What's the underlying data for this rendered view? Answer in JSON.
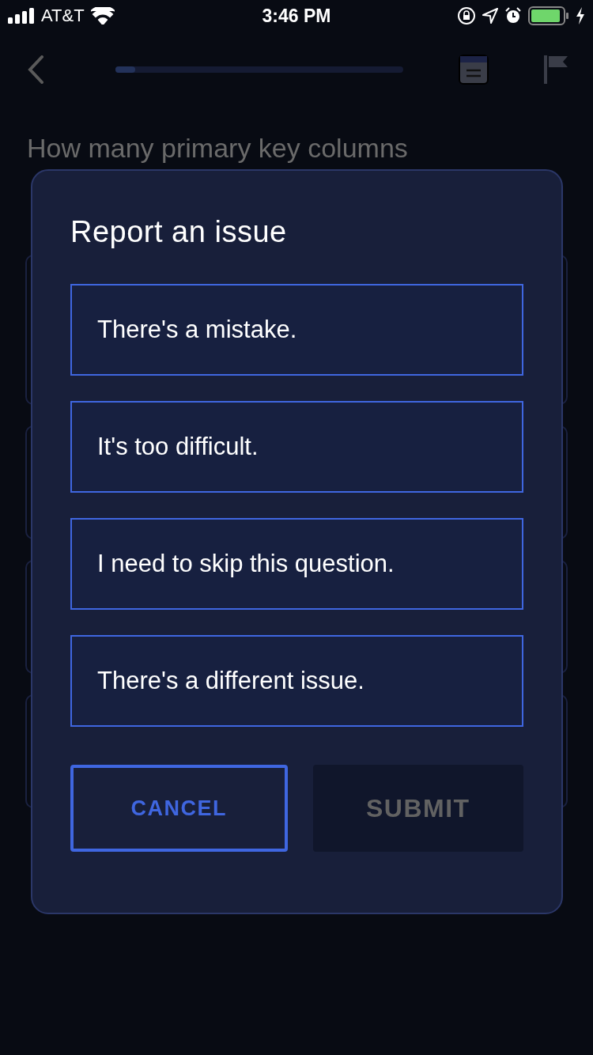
{
  "status_bar": {
    "carrier": "AT&T",
    "time": "3:46 PM"
  },
  "nav": {
    "progress": {
      "level": 0.07
    }
  },
  "question": {
    "text": "How many primary key columns"
  },
  "dialog": {
    "title": "Report an issue",
    "options": [
      {
        "label": "There's a mistake.",
        "selected": false
      },
      {
        "label": "It's too difficult.",
        "selected": false
      },
      {
        "label": "I need to skip this question.",
        "selected": false
      },
      {
        "label": "There's a different issue.",
        "selected": false
      }
    ],
    "cancel": {
      "label": "CANCEL"
    },
    "submit": {
      "label": "SUBMIT",
      "disabled": true
    }
  }
}
